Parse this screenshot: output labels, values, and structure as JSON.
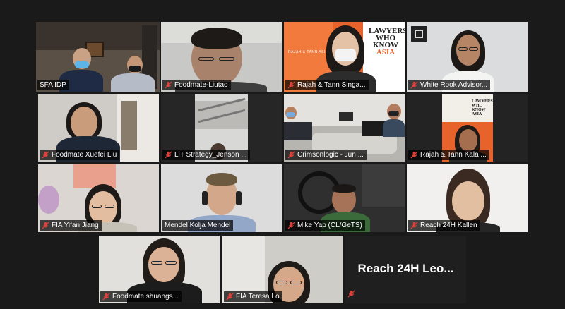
{
  "participants": [
    {
      "name": "SFA IDP"
    },
    {
      "name": "Foodmate-Liutao"
    },
    {
      "name": "Rajah & Tann Singa..."
    },
    {
      "name": "White Rook Advisor..."
    },
    {
      "name": "Foodmate Xuefei Liu"
    },
    {
      "name": "LiT Strategy_Jenson ..."
    },
    {
      "name": "Crimsonlogic - Jun ..."
    },
    {
      "name": "Rajah & Tann Kala ..."
    },
    {
      "name": "FIA Yifan Jiang"
    },
    {
      "name": "Mendel Kolja Mendel"
    },
    {
      "name": "Mike Yap (CL/GeTS)"
    },
    {
      "name": "Reach 24H Kallen"
    },
    {
      "name": "Foodmate shuangs..."
    },
    {
      "name": "FIA Teresa Lo"
    },
    {
      "name": "Reach 24H Leo..."
    }
  ],
  "backgrounds": {
    "lawyers_text_line1": "LAWYERS",
    "lawyers_text_line2": "WHO",
    "lawyers_text_line3": "KNOW",
    "lawyers_text_line4": "ASIA",
    "rajah_tann_tag": "RAJAH & TANN ASIA",
    "small_book_title": "LAWYERS WHO KNOW ASIA"
  },
  "colors": {
    "active_speaker": "#c8e23b",
    "muted_mic": "#e0413b",
    "rajah_orange": "#e8632b"
  }
}
